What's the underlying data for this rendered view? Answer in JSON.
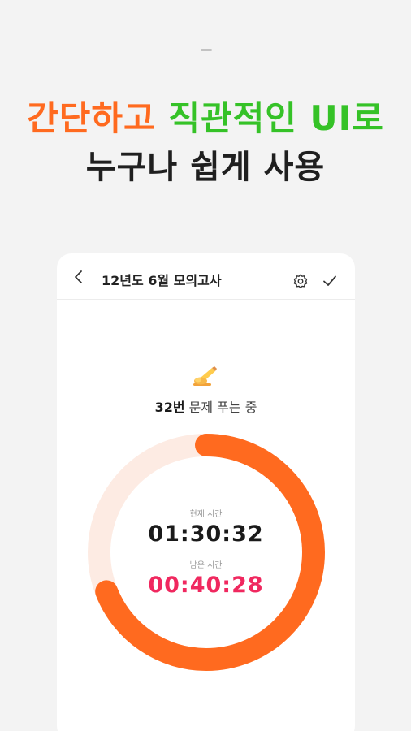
{
  "headline": {
    "line1_part1": "간단하고",
    "line1_part2": "직관적인 UI로",
    "line2": "누구나 쉽게 사용"
  },
  "colors": {
    "accent_orange": "#ff6a1f",
    "accent_green": "#35c227",
    "remaining_time": "#f0285f",
    "ring_track": "#fdebe3",
    "ring_progress": "#ff6a1f"
  },
  "app_bar": {
    "title": "12년도 6월 모의고사",
    "back_icon": "chevron-left-icon",
    "settings_icon": "gear-icon",
    "check_icon": "checkmark-icon"
  },
  "status": {
    "icon": "writing-hand-icon",
    "question_number": "32번",
    "question_status": "문제 푸는 중"
  },
  "timer": {
    "current_label": "현재 시간",
    "current_value": "01:30:32",
    "remaining_label": "남은 시간",
    "remaining_value": "00:40:28",
    "progress_fraction": 0.69
  }
}
